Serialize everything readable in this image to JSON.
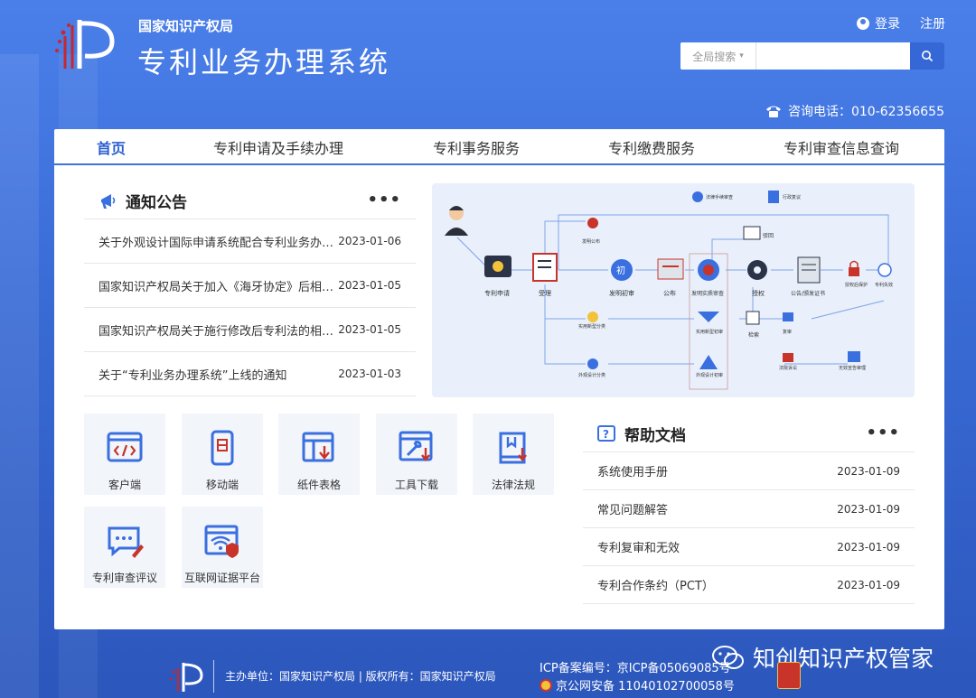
{
  "header": {
    "org_name": "国家知识产权局",
    "system_name": "专利业务办理系统",
    "login": "登录",
    "register": "注册",
    "search_scope": "全局搜索",
    "search_placeholder": "",
    "phone": "咨询电话：010-62356655"
  },
  "nav": [
    {
      "label": "首页",
      "active": true
    },
    {
      "label": "专利申请及手续办理"
    },
    {
      "label": "专利事务服务"
    },
    {
      "label": "专利缴费服务"
    },
    {
      "label": "专利审查信息查询"
    }
  ],
  "notice": {
    "title": "通知公告",
    "more": "•••",
    "items": [
      {
        "text": "关于外观设计国际申请系统配合专利业务办理系统上线的通知",
        "date": "2023-01-06"
      },
      {
        "text": "国家知识产权局关于加入《海牙协定》后相关业务处理的公告",
        "date": "2023-01-05"
      },
      {
        "text": "国家知识产权局关于施行修改后专利法的相关审查业务处理暂行办法",
        "date": "2023-01-05"
      },
      {
        "text": "关于“专利业务办理系统”上线的通知",
        "date": "2023-01-03"
      }
    ]
  },
  "flow": {
    "nodes": {
      "apply": "专利申请",
      "accept": "受理",
      "invent_prelim": "发明初审",
      "publish": "公布",
      "invent_substantive": "发明实质审查",
      "grant": "授权",
      "announce_cert": "公告/颁发证书",
      "after_grant": "授权后保护",
      "expire": "专利失效",
      "law_proc": "法律手续审查",
      "admin_review": "行政复议",
      "reject": "驳回",
      "utility_prelim": "实用新型初审",
      "design_prelim": "外观设计初审",
      "classify_a": "发明公布",
      "classify_b": "实用新型分类",
      "classify_c": "外观设计分类",
      "retrieve": "检索",
      "reexam": "复审",
      "lawsuit": "法院诉讼",
      "invalid": "无效宣告审理",
      "preliminary": "初"
    }
  },
  "tiles": [
    {
      "label": "客户端",
      "icon": "code-window-icon"
    },
    {
      "label": "移动端",
      "icon": "mobile-icon"
    },
    {
      "label": "纸件表格",
      "icon": "form-download-icon"
    },
    {
      "label": "工具下载",
      "icon": "tool-download-icon"
    },
    {
      "label": "法律法规",
      "icon": "law-book-icon"
    },
    {
      "label": "专利审查评议",
      "icon": "comment-edit-icon"
    },
    {
      "label": "互联网证据平台",
      "icon": "wifi-shield-icon"
    }
  ],
  "help": {
    "title": "帮助文档",
    "more": "•••",
    "items": [
      {
        "text": "系统使用手册",
        "date": "2023-01-09"
      },
      {
        "text": "常见问题解答",
        "date": "2023-01-09"
      },
      {
        "text": "专利复审和无效",
        "date": "2023-01-09"
      },
      {
        "text": "专利合作条约（PCT）",
        "date": "2023-01-09"
      }
    ]
  },
  "footer": {
    "host": "主办单位：国家知识产权局 | 版权所有：国家知识产权局",
    "icp": "ICP备案编号：京ICP备05069085号",
    "police": "京公网安备 11040102700058号",
    "watermark": "知创知识产权管家"
  },
  "colors": {
    "primary": "#3e73e0",
    "nav_active": "#2a5fd0",
    "tile_bg": "#f2f5fa"
  }
}
